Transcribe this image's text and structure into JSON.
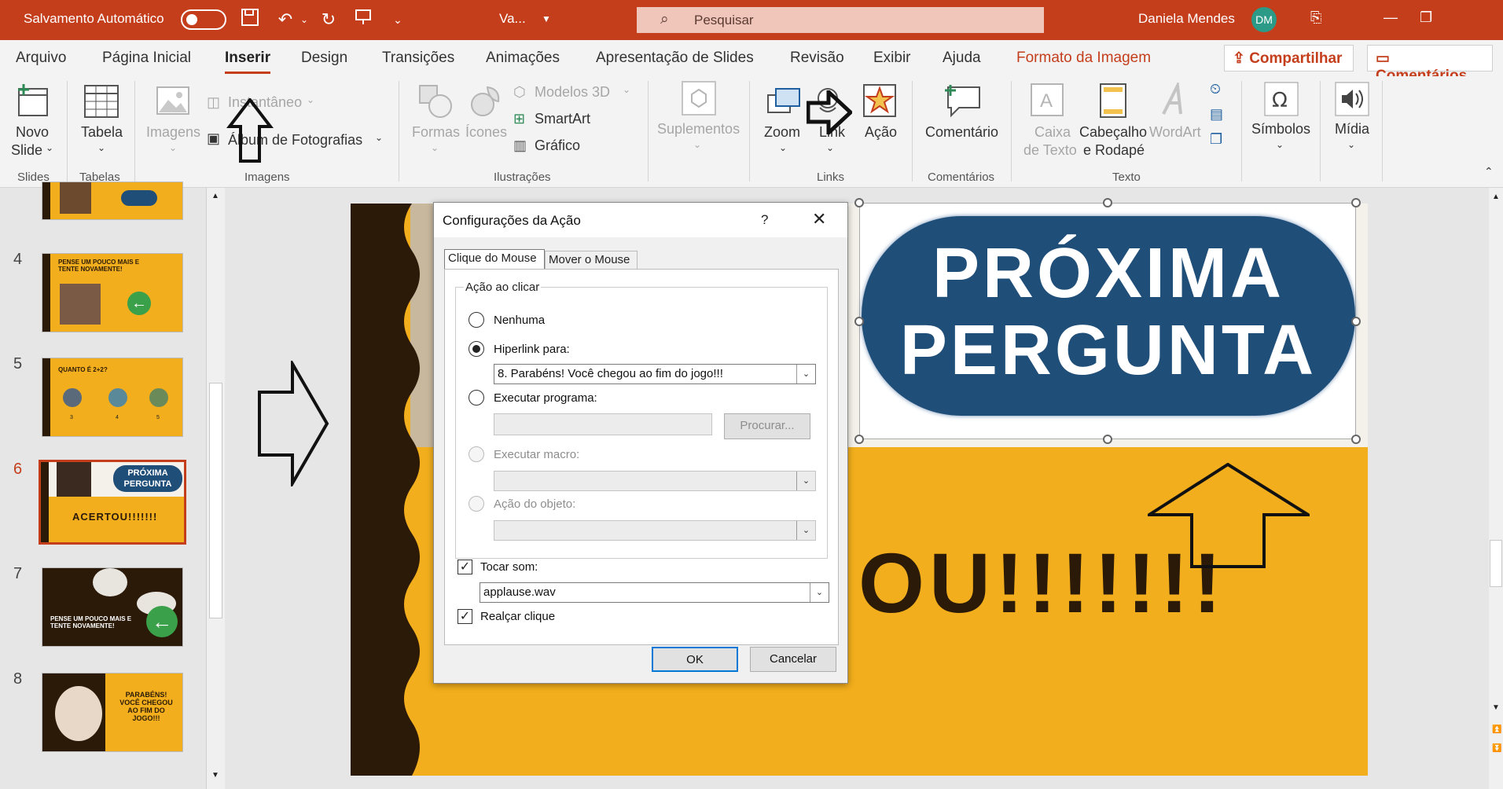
{
  "titlebar": {
    "autosave_label": "Salvamento Automático",
    "doc_name": "Va...",
    "search_placeholder": "Pesquisar",
    "user_name": "Daniela Mendes",
    "user_initials": "DM"
  },
  "tabs": [
    "Arquivo",
    "Página Inicial",
    "Inserir",
    "Design",
    "Transições",
    "Animações",
    "Apresentação de Slides",
    "Revisão",
    "Exibir",
    "Ajuda",
    "Formato da Imagem"
  ],
  "active_tab": "Inserir",
  "share_label": "Compartilhar",
  "comments_label": "Comentários",
  "ribbon": {
    "novo_slide": "Novo",
    "novo_slide2": "Slide",
    "tabela": "Tabela",
    "imagens": "Imagens",
    "instantaneo": "Instantâneo",
    "album": "Álbum de Fotografias",
    "formas": "Formas",
    "icones": "Ícones",
    "modelos3d": "Modelos 3D",
    "smartart": "SmartArt",
    "grafico": "Gráfico",
    "suplementos": "Suplementos",
    "zoom": "Zoom",
    "link": "Link",
    "acao": "Ação",
    "comentario": "Comentário",
    "caixa1": "Caixa",
    "caixa2": "de Texto",
    "cabecalho1": "Cabeçalho",
    "cabecalho2": "e Rodapé",
    "wordart": "WordArt",
    "simbolos": "Símbolos",
    "midia": "Mídia",
    "groups": {
      "slides": "Slides",
      "tabelas": "Tabelas",
      "imagens": "Imagens",
      "ilustracoes": "Ilustrações",
      "links": "Links",
      "comentarios": "Comentários",
      "texto": "Texto"
    }
  },
  "thumbnails": [
    {
      "num": "4",
      "text": "PENSE UM POUCO MAIS E TENTE NOVAMENTE!"
    },
    {
      "num": "5",
      "text": "QUANTO É 2+2?",
      "answers": [
        "3",
        "4",
        "5"
      ]
    },
    {
      "num": "6",
      "text": "ACERTOU!!!!!!!",
      "badge": "PRÓXIMA PERGUNTA"
    },
    {
      "num": "7",
      "text": "PENSE UM POUCO MAIS E TENTE NOVAMENTE!"
    },
    {
      "num": "8",
      "text": "PARABÉNS! VOCÊ CHEGOU AO FIM DO JOGO!!!"
    }
  ],
  "slide": {
    "badge_line1": "PRÓXIMA",
    "badge_line2": "PERGUNTA",
    "big_text": "OU!!!!!!!"
  },
  "dialog": {
    "title": "Configurações da Ação",
    "help": "?",
    "tab_click": "Clique do Mouse",
    "tab_hover": "Mover o Mouse",
    "group_label": "Ação ao clicar",
    "opt_none": "Nenhuma",
    "opt_hyperlink": "Hiperlink para:",
    "hyperlink_value": "8. Parabéns! Você chegou ao fim do jogo!!!",
    "opt_run_program": "Executar programa:",
    "browse": "Procurar...",
    "opt_run_macro": "Executar macro:",
    "opt_object_action": "Ação do objeto:",
    "play_sound": "Tocar som:",
    "sound_value": "applause.wav",
    "highlight_click": "Realçar clique",
    "ok": "OK",
    "cancel": "Cancelar"
  },
  "colors": {
    "accent": "#c43e1c",
    "slide_yellow": "#f2ae1c",
    "slide_brown": "#2b1a08",
    "badge_blue": "#1f4e79"
  }
}
